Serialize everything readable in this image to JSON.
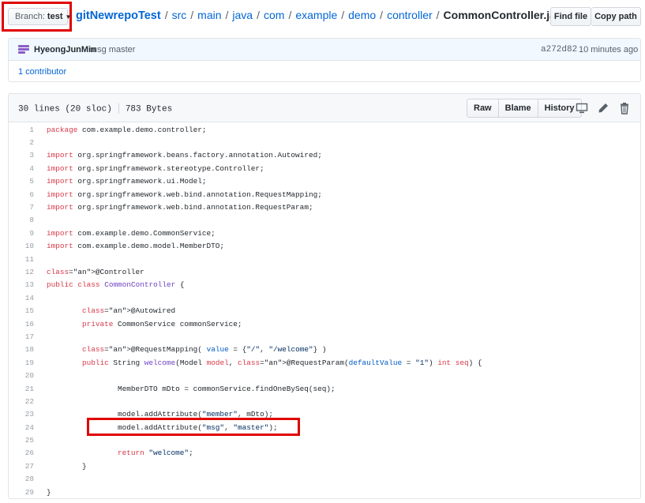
{
  "branch": {
    "prefix": "Branch:",
    "name": "test"
  },
  "breadcrumb": {
    "repo": "gitNewrepoTest",
    "segments": [
      "src",
      "main",
      "java",
      "com",
      "example",
      "demo",
      "controller"
    ],
    "file": "CommonController.java"
  },
  "actions": {
    "find_file": "Find file",
    "copy_path": "Copy path"
  },
  "commit": {
    "author": "HyeongJunMin",
    "message": "msg master",
    "sha": "a272d82",
    "time_ago": "10 minutes ago",
    "contributors": "1 contributor"
  },
  "file": {
    "lines_info": "30 lines (20 sloc)",
    "size": "783 Bytes",
    "buttons": {
      "raw": "Raw",
      "blame": "Blame",
      "history": "History"
    }
  },
  "icons": {
    "desktop": "desktop-icon",
    "edit": "pencil-icon",
    "delete": "trash-icon"
  },
  "code_lines": [
    "package com.example.demo.controller;",
    "",
    "import org.springframework.beans.factory.annotation.Autowired;",
    "import org.springframework.stereotype.Controller;",
    "import org.springframework.ui.Model;",
    "import org.springframework.web.bind.annotation.RequestMapping;",
    "import org.springframework.web.bind.annotation.RequestParam;",
    "",
    "import com.example.demo.CommonService;",
    "import com.example.demo.model.MemberDTO;",
    "",
    "@Controller",
    "public class CommonController {",
    "",
    "        @Autowired",
    "        private CommonService commonService;",
    "",
    "        @RequestMapping( value = {\"/\", \"/welcome\"} )",
    "        public String welcome(Model model, @RequestParam(defaultValue = \"1\") int seq) {",
    "",
    "                MemberDTO mDto = commonService.findOneBySeq(seq);",
    "",
    "                model.addAttribute(\"member\", mDto);",
    "                model.addAttribute(\"msg\", \"master\");",
    "",
    "                return \"welcome\";",
    "        }",
    "",
    "}"
  ],
  "colors": {
    "accent": "#0366d6",
    "highlight": "#e00000"
  }
}
